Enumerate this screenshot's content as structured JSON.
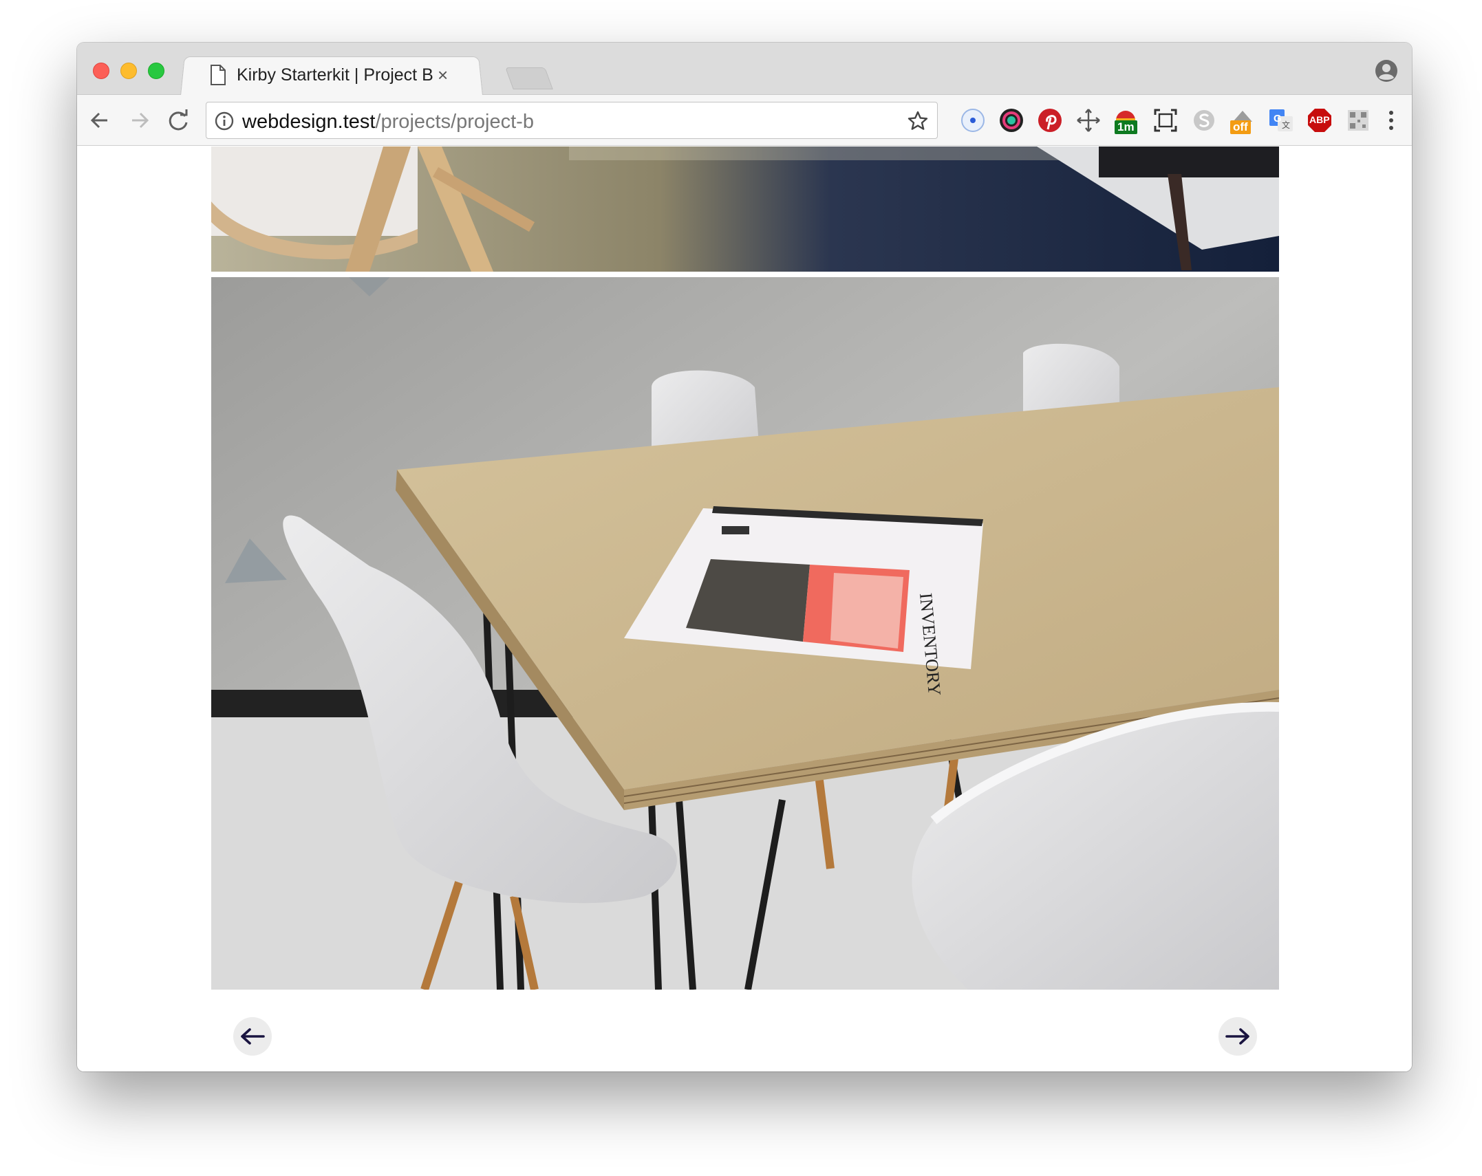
{
  "browser": {
    "tab": {
      "title": "Kirby Starterkit | Project B",
      "close_symbol": "×",
      "icon": "document-icon"
    },
    "address_bar": {
      "host": "webdesign.test",
      "path": "/projects/project-b",
      "info_icon": "info-icon",
      "bookmark_icon": "star-icon"
    },
    "extensions": [
      {
        "name": "eye-dropper-extension",
        "badge": ""
      },
      {
        "name": "color-wheel-extension",
        "badge": ""
      },
      {
        "name": "pinterest-extension",
        "badge": ""
      },
      {
        "name": "dimensions-extension",
        "badge": ""
      },
      {
        "name": "timer-extension",
        "badge": "1m"
      },
      {
        "name": "screenshot-extension",
        "badge": ""
      },
      {
        "name": "skype-extension",
        "badge": ""
      },
      {
        "name": "hide-extension",
        "badge": "off"
      },
      {
        "name": "google-translate-extension",
        "badge": ""
      },
      {
        "name": "adblock-plus-extension",
        "badge": "ABP"
      },
      {
        "name": "qr-code-extension",
        "badge": ""
      }
    ]
  },
  "page": {
    "images": [
      {
        "name": "project-photo-chair-rug",
        "alt": ""
      },
      {
        "name": "project-photo-table-chairs",
        "alt": ""
      }
    ],
    "magazine_cover_text": "INVENTORY",
    "pager": {
      "prev_icon": "arrow-left-icon",
      "next_icon": "arrow-right-icon"
    }
  },
  "colors": {
    "arrow": "#1a1440",
    "pager_bg": "#ececec",
    "close_red": "#fc5f57",
    "minimize_yellow": "#fdbc2e",
    "maximize_green": "#28c840"
  }
}
